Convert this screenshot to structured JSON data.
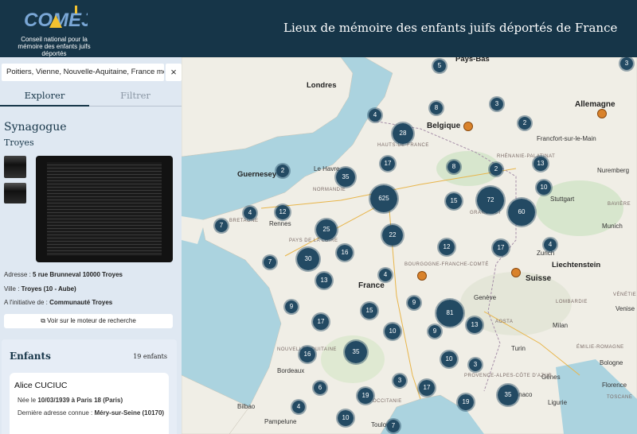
{
  "header": {
    "logo_text": "COMEJD",
    "logo_caption": "Conseil national pour la mémoire des enfants juifs déportés",
    "title": "Lieux de mémoire des enfants juifs déportés de France"
  },
  "sidebar": {
    "search_value": "Poitiers, Vienne, Nouvelle-Aquitaine, France métropolitaine",
    "clear_label": "×",
    "tabs": [
      {
        "label": "Explorer",
        "active": true
      },
      {
        "label": "Filtrer",
        "active": false
      }
    ],
    "place": {
      "type": "Synagogue",
      "city": "Troyes",
      "address_label": "Adresse : ",
      "address_value": "5 rue Brunneval 10000 Troyes",
      "city_label": "Ville : ",
      "city_value": "Troyes (10 - Aube)",
      "initiative_label": "A l'initiative de : ",
      "initiative_value": "Communauté Troyes",
      "search_engine_button": "Voir sur le moteur de recherche"
    },
    "children": {
      "title": "Enfants",
      "count": "19 enfants",
      "first": {
        "name": "Alice CUCIUC",
        "birth_label": "Née le ",
        "birth_value": "10/03/1939 à Paris 18 (Paris)",
        "last_address_label": "Dernière adresse connue : ",
        "last_address_value": "Méry-sur-Seine (10170)"
      }
    }
  },
  "map": {
    "labels": [
      {
        "text": "Pays-Bas",
        "type": "big"
      },
      {
        "text": "Londres",
        "type": "big"
      },
      {
        "text": "Belgique",
        "type": "country"
      },
      {
        "text": "Allemagne",
        "type": "country"
      },
      {
        "text": "Guernesey",
        "type": "big"
      },
      {
        "text": "France",
        "type": "country"
      },
      {
        "text": "Suisse",
        "type": "country"
      },
      {
        "text": "Liechtenstein",
        "type": "big"
      },
      {
        "text": "Rennes",
        "type": "city"
      },
      {
        "text": "Le Havre",
        "type": "city"
      },
      {
        "text": "Zurich",
        "type": "city"
      },
      {
        "text": "Genève",
        "type": "city"
      },
      {
        "text": "Stuttgart",
        "type": "city"
      },
      {
        "text": "Nuremberg",
        "type": "city"
      },
      {
        "text": "Francfort-sur-le-Main",
        "type": "city"
      },
      {
        "text": "Munich",
        "type": "city"
      },
      {
        "text": "Bilbao",
        "type": "city"
      },
      {
        "text": "Pampelune",
        "type": "city"
      },
      {
        "text": "Milan",
        "type": "city"
      },
      {
        "text": "Turin",
        "type": "city"
      },
      {
        "text": "Gênes",
        "type": "city"
      },
      {
        "text": "Venise",
        "type": "city"
      },
      {
        "text": "Bologne",
        "type": "city"
      },
      {
        "text": "Florence",
        "type": "city"
      },
      {
        "text": "Monaco",
        "type": "city"
      },
      {
        "text": "Ligurie",
        "type": "city"
      },
      {
        "text": "Bordeaux",
        "type": "city"
      },
      {
        "text": "Toulouse",
        "type": "city"
      },
      {
        "text": "BRETAGNE",
        "type": "region"
      },
      {
        "text": "NORMANDIE",
        "type": "region"
      },
      {
        "text": "PAYS DE LA LOIRE",
        "type": "region"
      },
      {
        "text": "BOURGOGNE-FRANCHE-COMTÉ",
        "type": "region"
      },
      {
        "text": "PROVENCE-ALPES-CÔTE D'AZUR",
        "type": "region"
      },
      {
        "text": "HAUTS-DE-FRANCE",
        "type": "region"
      },
      {
        "text": "GRAND EST",
        "type": "region"
      },
      {
        "text": "RHÉNANIE-PALATINAT",
        "type": "region"
      },
      {
        "text": "BAVIÈRE",
        "type": "region"
      },
      {
        "text": "LOMBARDIE",
        "type": "region"
      },
      {
        "text": "VÉNÉTIE",
        "type": "region"
      },
      {
        "text": "ÉMILIE-ROMAGNE",
        "type": "region"
      },
      {
        "text": "AOSTA",
        "type": "region"
      },
      {
        "text": "TOSCANE",
        "type": "region"
      },
      {
        "text": "NOUVELLE-AQUITAINE",
        "type": "region"
      },
      {
        "text": "OCCITANIE",
        "type": "region"
      }
    ],
    "clusters": [
      "5",
      "3",
      "8",
      "3",
      "4",
      "28",
      "2",
      "17",
      "2",
      "13",
      "35",
      "2",
      "8",
      "625",
      "72",
      "60",
      "10",
      "4",
      "12",
      "15",
      "7",
      "25",
      "22",
      "12",
      "17",
      "4",
      "7",
      "30",
      "16",
      "13",
      "4",
      "9",
      "15",
      "81",
      "9",
      "17",
      "10",
      "9",
      "13",
      "16",
      "35",
      "10",
      "3",
      "3",
      "6",
      "19",
      "17",
      "35",
      "4",
      "19",
      "10",
      "7"
    ]
  },
  "colors": {
    "header_bg": "#163548",
    "sidebar_bg": "#dfe8f2",
    "cluster": "#234a63",
    "sea": "#abd3df",
    "land": "#f0eee6"
  }
}
